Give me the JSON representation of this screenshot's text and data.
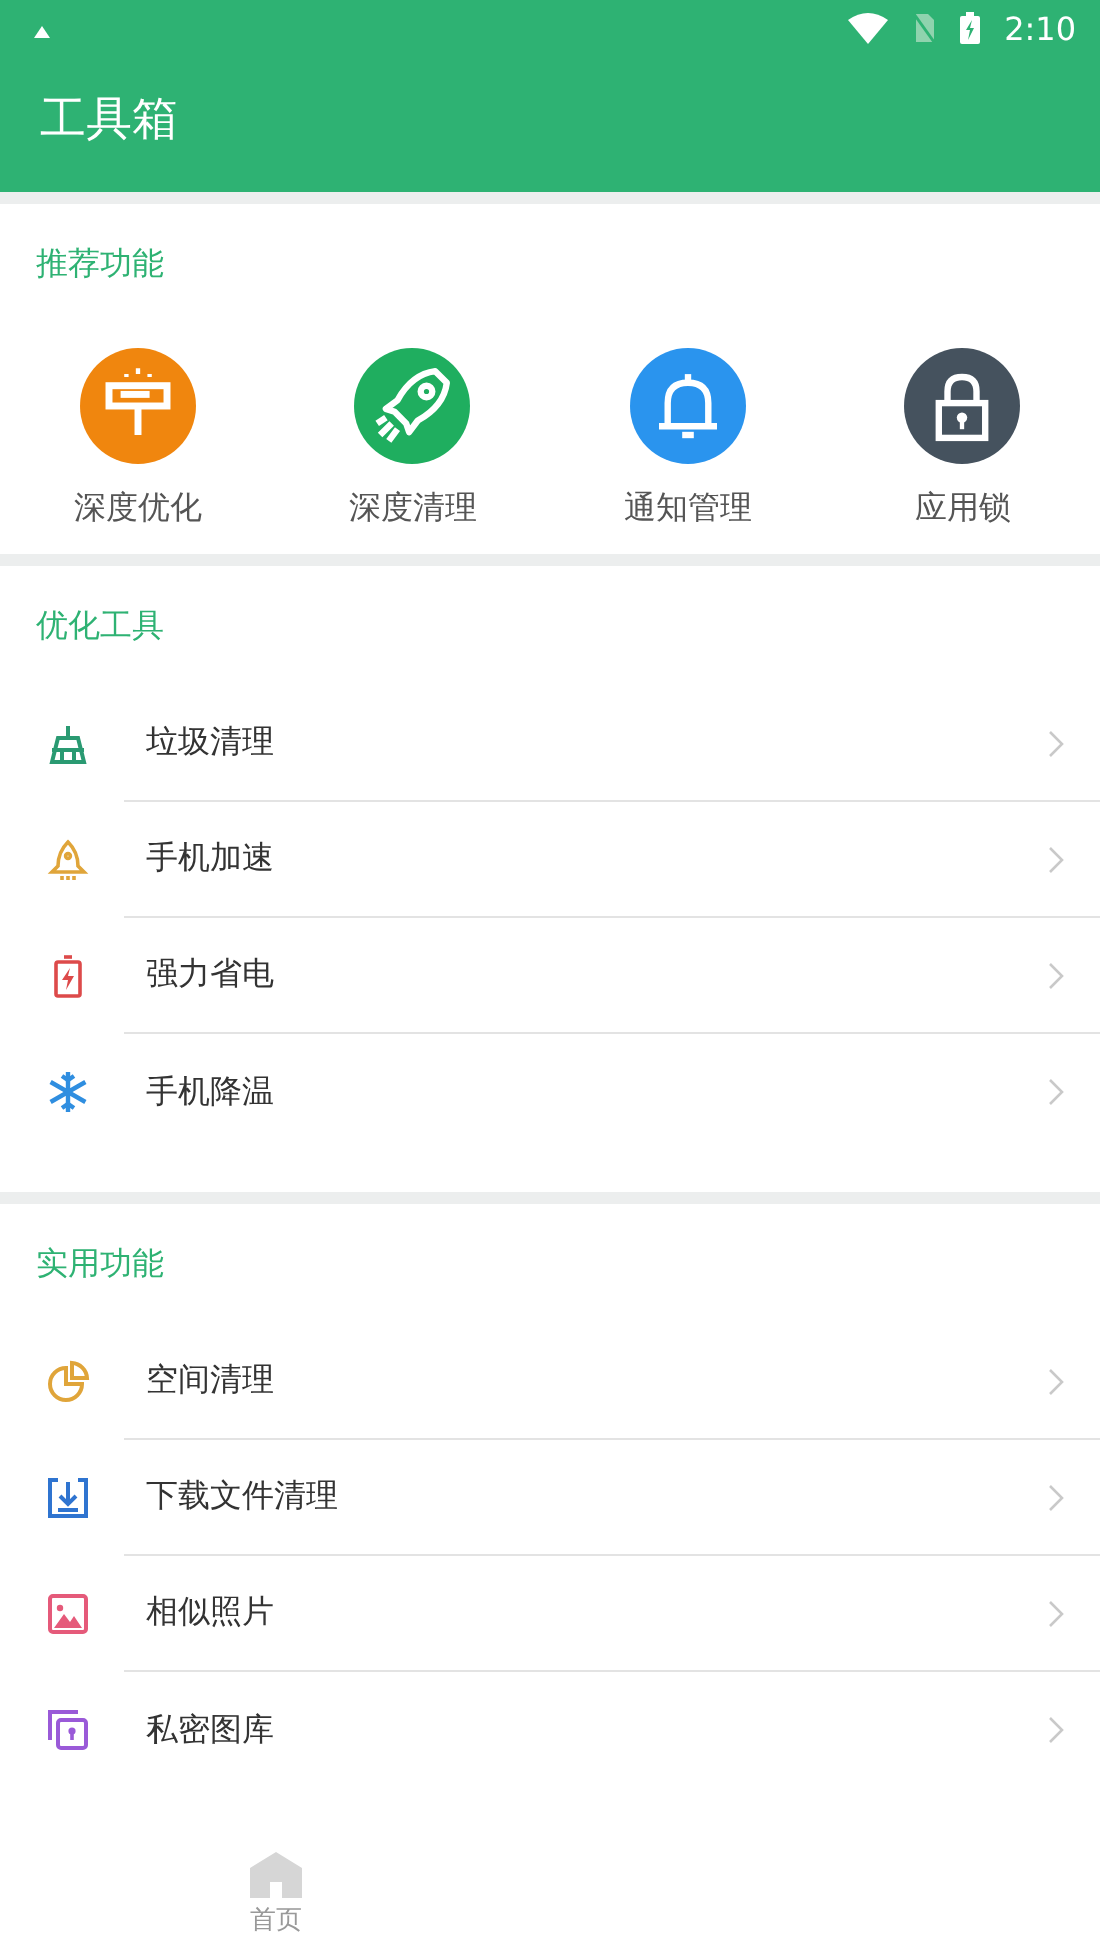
{
  "status_bar": {
    "time": "2:10"
  },
  "app_bar": {
    "title": "工具箱"
  },
  "featured": {
    "title": "推荐功能",
    "items": [
      {
        "label": "深度优化"
      },
      {
        "label": "深度清理"
      },
      {
        "label": "通知管理"
      },
      {
        "label": "应用锁"
      }
    ]
  },
  "sections": [
    {
      "title": "优化工具",
      "rows": [
        {
          "label": "垃圾清理"
        },
        {
          "label": "手机加速"
        },
        {
          "label": "强力省电"
        },
        {
          "label": "手机降温"
        }
      ]
    },
    {
      "title": "实用功能",
      "rows": [
        {
          "label": "空间清理"
        },
        {
          "label": "下载文件清理"
        },
        {
          "label": "相似照片"
        },
        {
          "label": "私密图库"
        }
      ]
    }
  ],
  "bottom_nav": [
    {
      "label": "首页",
      "selected": false
    }
  ]
}
